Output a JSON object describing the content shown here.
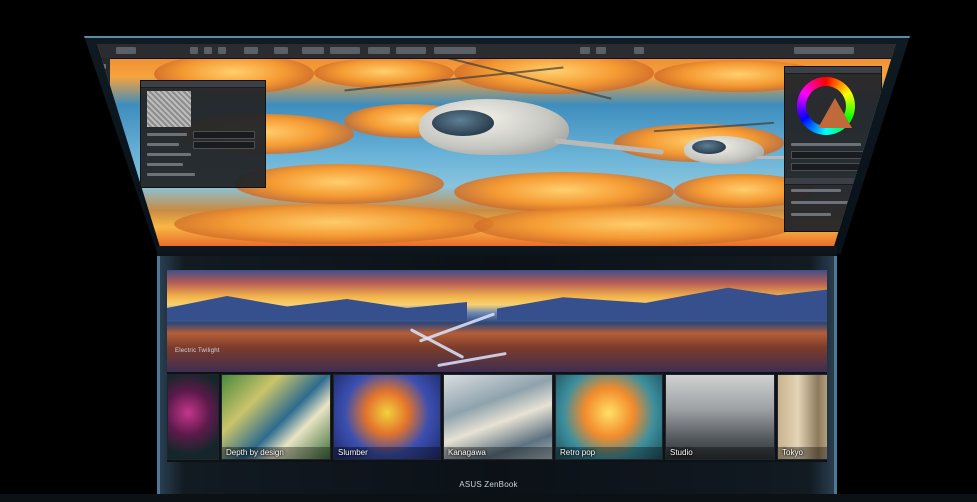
{
  "product": {
    "brand_text": "ASUS ZenBook"
  },
  "screenpad": {
    "featured_caption": "Electric Twilight",
    "thumbnails": [
      {
        "label": ""
      },
      {
        "label": "Depth by design"
      },
      {
        "label": "Slumber"
      },
      {
        "label": "Kanagawa"
      },
      {
        "label": "Retro pop"
      },
      {
        "label": "Studio"
      },
      {
        "label": "Tokyo"
      }
    ]
  },
  "colors": {
    "bezel_accent": "#5f8aa6",
    "sky_orange": "#f59a32",
    "sky_blue": "#4b9ccb"
  },
  "icons": {
    "color_wheel": "color-wheel-icon",
    "toolbar": "toolbar-icon"
  }
}
